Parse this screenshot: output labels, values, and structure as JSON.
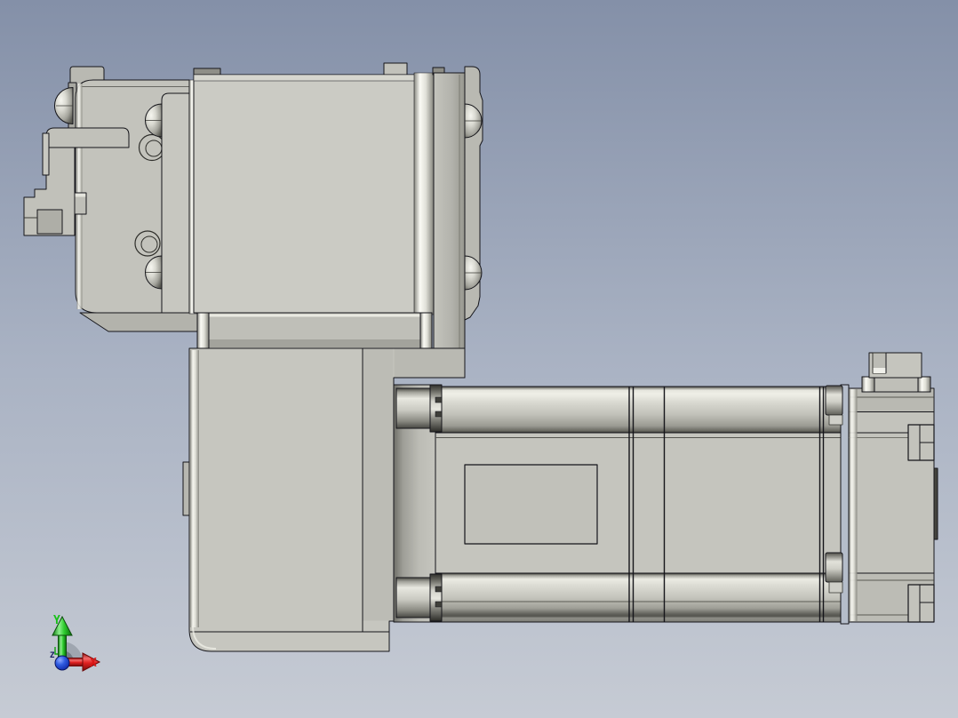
{
  "app": {
    "title": "3D CAD viewport",
    "view": "front orthographic shaded view"
  },
  "triad": {
    "x_label": "X",
    "y_label": "Y",
    "z_label": "Z",
    "x_color": "#d81616",
    "y_color": "#17c117",
    "z_color": "#161a60",
    "origin_color": "#1a44cc",
    "sector_color": "#9ba2ac"
  },
  "scene": {
    "background_top": "#8490a8",
    "background_mid": "#a9b2c3",
    "background_bottom": "#c6cbd4",
    "part_base_color": "#c6c6bf",
    "edge_color": "#15151a",
    "metal_highlight_color": "#fbfbf5"
  },
  "parts": [
    {
      "id": "mounting-clip-bracket",
      "label": "mounting clip bracket"
    },
    {
      "id": "clip-arm",
      "label": "clip arm"
    },
    {
      "id": "gearhead-left-block",
      "label": "gearhead left block"
    },
    {
      "id": "button-head-screw",
      "label": "button head screw"
    },
    {
      "id": "gearhead-face-plate",
      "label": "gearhead face plate"
    },
    {
      "id": "rear-mount-tab",
      "label": "rear mount tab"
    },
    {
      "id": "motor-flange-band",
      "label": "motor flange band"
    },
    {
      "id": "gearbox-housing",
      "label": "gearbox housing"
    },
    {
      "id": "actuator-end-block",
      "label": "actuator end block"
    },
    {
      "id": "guide-rod-boss",
      "label": "guide rod boss"
    },
    {
      "id": "top-guide-rod",
      "label": "top guide rod"
    },
    {
      "id": "bottom-guide-rod",
      "label": "bottom guide rod"
    },
    {
      "id": "slider-body",
      "label": "slider body"
    },
    {
      "id": "slider-recess",
      "label": "slider recess"
    },
    {
      "id": "sensor-clamp",
      "label": "sensor clamp"
    },
    {
      "id": "motor-housing",
      "label": "motor housing"
    },
    {
      "id": "motor-connector",
      "label": "motor connector"
    }
  ]
}
